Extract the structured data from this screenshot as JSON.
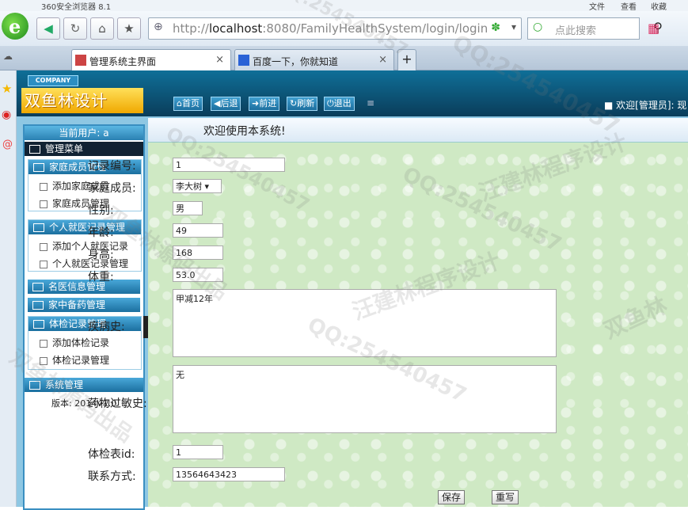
{
  "browser": {
    "title": "360安全浏览器 8.1",
    "menu": [
      "文件",
      "查看",
      "收藏"
    ],
    "url_host": "localhost",
    "url_rest": ":8080/FamilyHealthSystem/login/login",
    "url_prefix": "http://",
    "search_placeholder": "点此搜索",
    "tabs": [
      {
        "label": "管理系统主界面",
        "active": true
      },
      {
        "label": "百度一下，你就知道",
        "active": false
      }
    ]
  },
  "app": {
    "company": "COMPANY",
    "brand": "双鱼林设计",
    "toolbar": [
      "首页",
      "后退",
      "前进",
      "刷新",
      "退出"
    ],
    "welcome": "欢迎[管理员]:  现"
  },
  "sidebar": {
    "current_user": "当前用户: a",
    "menu_title": "管理菜单",
    "groups": [
      {
        "title": "家庭成员管理",
        "items": [
          "添加家庭成员",
          "家庭成员管理"
        ]
      },
      {
        "title": "个人就医记录管理",
        "items": [
          "添加个人就医记录",
          "个人就医记录管理"
        ]
      },
      {
        "title": "名医信息管理",
        "items": []
      },
      {
        "title": "家中备药管理",
        "items": []
      },
      {
        "title": "体检记录管理",
        "items": [
          "添加体检记录",
          "体检记录管理"
        ]
      }
    ],
    "system_title": "系统管理",
    "version": "版本: 2014V1.0"
  },
  "content": {
    "heading": "欢迎使用本系统!",
    "form": {
      "record_no_label": "记录编号:",
      "record_no": "1",
      "member_label": "家庭成员:",
      "member": "李大树",
      "gender_label": "性别:",
      "gender": "男",
      "age_label": "年龄:",
      "age": "49",
      "height_label": "身高:",
      "height": "168",
      "weight_label": "体重:",
      "weight": "53.0",
      "history_label": "疾病史:",
      "history": "甲减12年",
      "allergy_label": "药物过敏史:",
      "allergy": "无",
      "exam_id_label": "体检表id:",
      "exam_id": "1",
      "contact_label": "联系方式:",
      "contact": "13564643423",
      "save": "保存",
      "reset": "重写"
    }
  },
  "watermarks": [
    "QQ:254540457",
    "汪建林程序设计",
    "双鱼林源码出品",
    "双鱼林"
  ]
}
